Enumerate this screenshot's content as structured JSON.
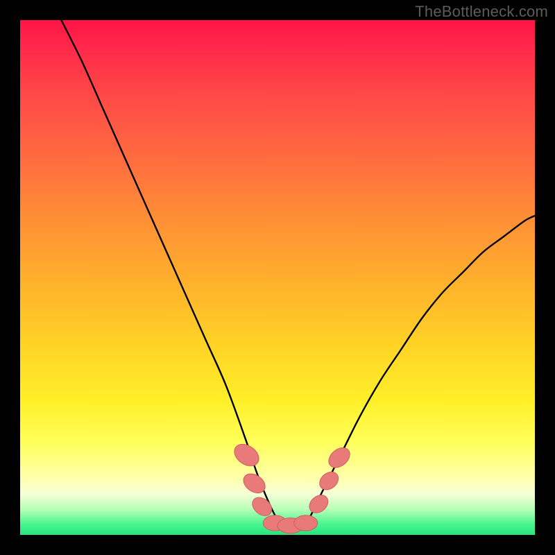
{
  "watermark": "TheBottleneck.com",
  "colors": {
    "gradient_top": "#ff1446",
    "gradient_mid": "#ffd026",
    "gradient_bottom": "#28e37e",
    "curve": "#000000",
    "marker_fill": "#e87a7a",
    "marker_stroke": "#d05f5f"
  },
  "chart_data": {
    "type": "line",
    "title": "",
    "xlabel": "",
    "ylabel": "",
    "xlim": [
      0,
      100
    ],
    "ylim": [
      0,
      100
    ],
    "grid": false,
    "legend": false,
    "series": [
      {
        "name": "bottleneck-curve",
        "x": [
          8,
          12,
          16,
          20,
          24,
          28,
          32,
          36,
          40,
          44,
          46,
          48,
          50,
          52,
          54,
          56,
          58,
          62,
          66,
          70,
          74,
          78,
          82,
          86,
          90,
          94,
          98,
          100
        ],
        "y": [
          100,
          92,
          83,
          74,
          65,
          56,
          47,
          38,
          29,
          18,
          12,
          7,
          3,
          1.5,
          1.5,
          3,
          7,
          15,
          23,
          30,
          36,
          42,
          47,
          51,
          55,
          58,
          61,
          62
        ]
      }
    ],
    "markers": [
      {
        "x": 44.0,
        "y": 15.5,
        "rx": 1.8,
        "ry": 2.6,
        "rot": -55
      },
      {
        "x": 45.5,
        "y": 10.0,
        "rx": 1.6,
        "ry": 2.3,
        "rot": -55
      },
      {
        "x": 47.0,
        "y": 5.5,
        "rx": 1.5,
        "ry": 2.1,
        "rot": -50
      },
      {
        "x": 49.5,
        "y": 2.3,
        "rx": 2.3,
        "ry": 1.5,
        "rot": 0
      },
      {
        "x": 52.5,
        "y": 1.8,
        "rx": 2.5,
        "ry": 1.5,
        "rot": 0
      },
      {
        "x": 55.5,
        "y": 2.3,
        "rx": 2.3,
        "ry": 1.5,
        "rot": 0
      },
      {
        "x": 58.0,
        "y": 6.0,
        "rx": 1.5,
        "ry": 2.0,
        "rot": 50
      },
      {
        "x": 60.0,
        "y": 10.5,
        "rx": 1.5,
        "ry": 2.0,
        "rot": 50
      },
      {
        "x": 62.0,
        "y": 15.0,
        "rx": 1.6,
        "ry": 2.3,
        "rot": 50
      }
    ]
  }
}
